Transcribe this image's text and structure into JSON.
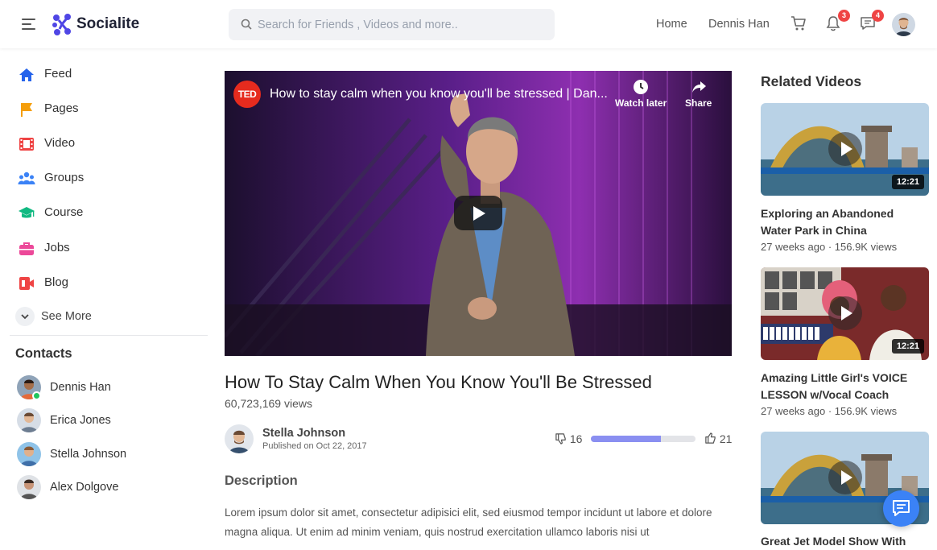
{
  "header": {
    "brand": "Socialite",
    "search_placeholder": "Search for Friends , Videos and more..",
    "nav_home": "Home",
    "nav_user": "Dennis Han",
    "notifications_count": "3",
    "messages_count": "4"
  },
  "sidebar": {
    "items": [
      {
        "label": "Feed",
        "icon": "home-icon",
        "color": "#2563eb"
      },
      {
        "label": "Pages",
        "icon": "flag-icon",
        "color": "#f59e0b"
      },
      {
        "label": "Video",
        "icon": "film-icon",
        "color": "#ef4444"
      },
      {
        "label": "Groups",
        "icon": "users-icon",
        "color": "#3b82f6"
      },
      {
        "label": "Course",
        "icon": "graduation-cap-icon",
        "color": "#10b981"
      },
      {
        "label": "Jobs",
        "icon": "briefcase-icon",
        "color": "#ec4899"
      },
      {
        "label": "Blog",
        "icon": "blog-icon",
        "color": "#ef4444"
      }
    ],
    "see_more": "See More"
  },
  "contacts": {
    "title": "Contacts",
    "items": [
      {
        "name": "Dennis Han",
        "online": true
      },
      {
        "name": "Erica Jones",
        "online": false
      },
      {
        "name": "Stella Johnson",
        "online": false
      },
      {
        "name": "Alex Dolgove",
        "online": false
      }
    ]
  },
  "video": {
    "player_title": "How to stay calm when you know you'll be stressed | Dan...",
    "channel_logo": "TED",
    "watch_later": "Watch later",
    "share": "Share",
    "title": "How To Stay Calm When You Know You'll Be Stressed",
    "views": "60,723,169 views",
    "author": "Stella Johnson",
    "published": "Published on Oct 22, 2017",
    "dislikes": "16",
    "likes": "21",
    "like_ratio": 0.67,
    "description_title": "Description",
    "description": "Lorem ipsum dolor sit amet, consectetur adipisici elit, sed eiusmod tempor incidunt ut labore et dolore magna aliqua. Ut enim ad minim veniam, quis nostrud exercitation ullamco laboris nisi ut"
  },
  "related": {
    "title": "Related Videos",
    "items": [
      {
        "title": "Exploring an Abandoned Water Park in China",
        "meta": "27 weeks ago · 156.9K views",
        "duration": "12:21"
      },
      {
        "title": "Amazing Little Girl's VOICE LESSON w/Vocal Coach",
        "meta": "27 weeks ago · 156.9K views",
        "duration": "12:21"
      },
      {
        "title": "Great Jet Model Show With",
        "meta": "",
        "duration": ""
      }
    ]
  }
}
